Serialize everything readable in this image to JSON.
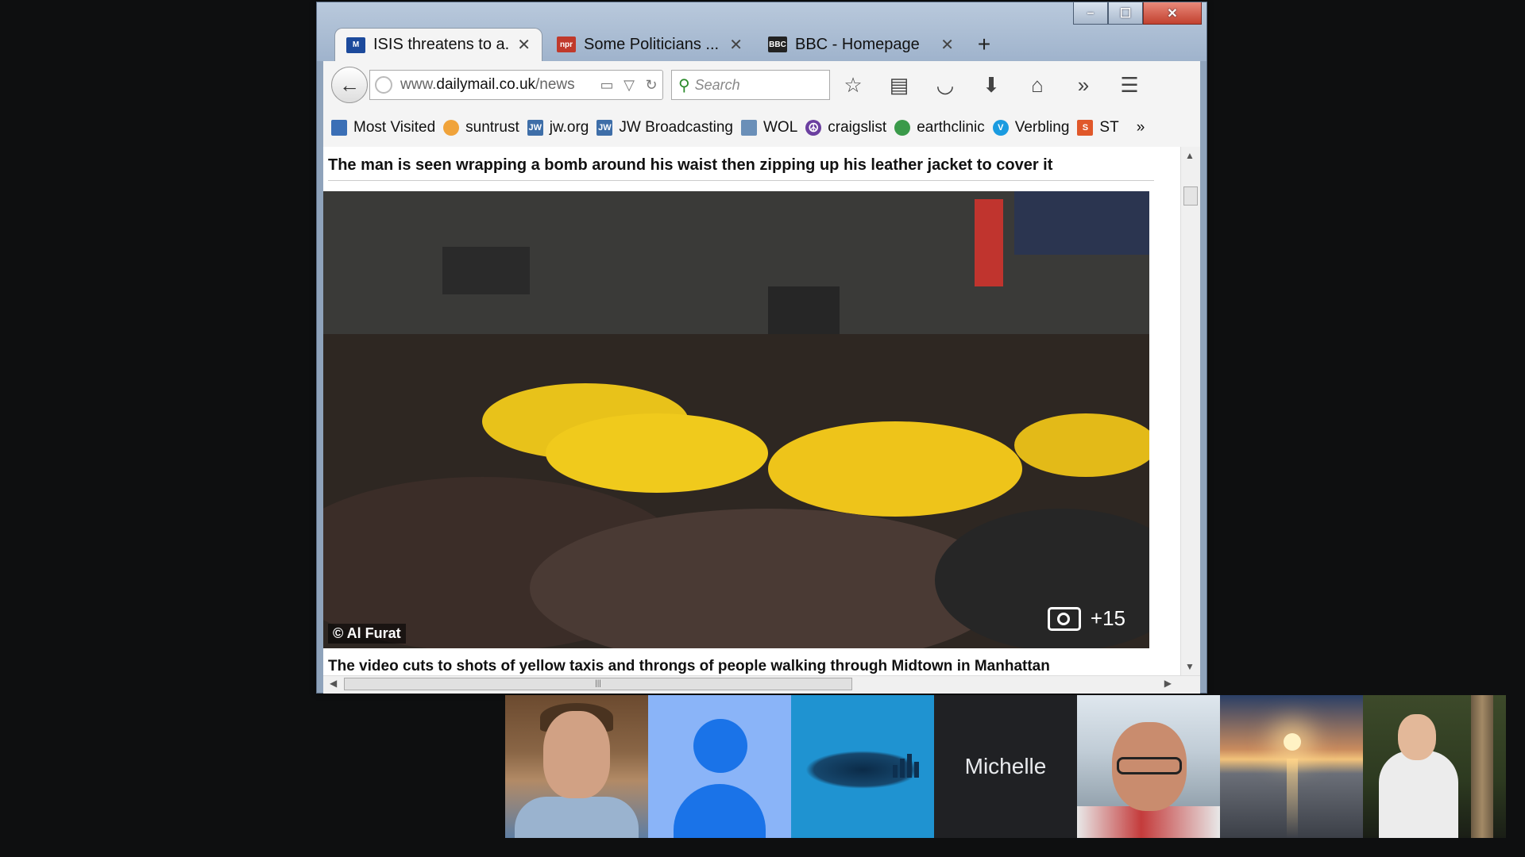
{
  "window": {
    "controls": {
      "minimize": "–",
      "maximize": "☐",
      "close": "✕"
    }
  },
  "tabs": [
    {
      "label": "ISIS threatens to a...",
      "icon": "dailymail-favicon",
      "active": true,
      "close": "✕"
    },
    {
      "label": "Some Politicians ...",
      "icon": "npr-favicon",
      "active": false,
      "close": "✕"
    },
    {
      "label": "BBC - Homepage",
      "icon": "bbc-favicon",
      "active": false,
      "close": "✕"
    }
  ],
  "new_tab": "+",
  "nav": {
    "back": "←",
    "url_plain": "www.",
    "url_domain": "dailymail.co.uk",
    "url_path": "/news",
    "reload": "↻",
    "search_placeholder": "Search"
  },
  "toolbar_icons": [
    "star-icon",
    "reading-list-icon",
    "pocket-icon",
    "download-icon",
    "home-icon",
    "overflow-icon",
    "menu-icon"
  ],
  "bookmarks": [
    {
      "label": "Most Visited",
      "icon_text": "",
      "color": "#3b6fb6"
    },
    {
      "label": "suntrust",
      "icon_text": "",
      "color": "#f0a33a"
    },
    {
      "label": "jw.org",
      "icon_text": "JW",
      "color": "#3e6ea8"
    },
    {
      "label": "JW Broadcasting",
      "icon_text": "JW",
      "color": "#3e6ea8"
    },
    {
      "label": "WOL",
      "icon_text": "",
      "color": "#6a8fb8"
    },
    {
      "label": "craigslist",
      "icon_text": "☮",
      "color": "#6b3fa0"
    },
    {
      "label": "earthclinic",
      "icon_text": "",
      "color": "#3a9a4a"
    },
    {
      "label": "Verbling",
      "icon_text": "V",
      "color": "#1a9be0"
    },
    {
      "label": "ST",
      "icon_text": "S",
      "color": "#e0582a"
    }
  ],
  "bookmarks_more": "»",
  "article": {
    "headline": "The man is seen wrapping a bomb around his waist then zipping up his leather jacket to cover it",
    "photo_credit": "© Al Furat",
    "gallery_count": "+15",
    "caption": "The video cuts to shots of yellow taxis and throngs of people walking through Midtown in Manhattan"
  },
  "participants": [
    {
      "name": "",
      "type": "camera"
    },
    {
      "name": "",
      "type": "placeholder-avatar"
    },
    {
      "name": "",
      "type": "logo"
    },
    {
      "name": "Michelle",
      "type": "name-only"
    },
    {
      "name": "",
      "type": "camera"
    },
    {
      "name": "",
      "type": "photo"
    },
    {
      "name": "",
      "type": "photo"
    }
  ]
}
